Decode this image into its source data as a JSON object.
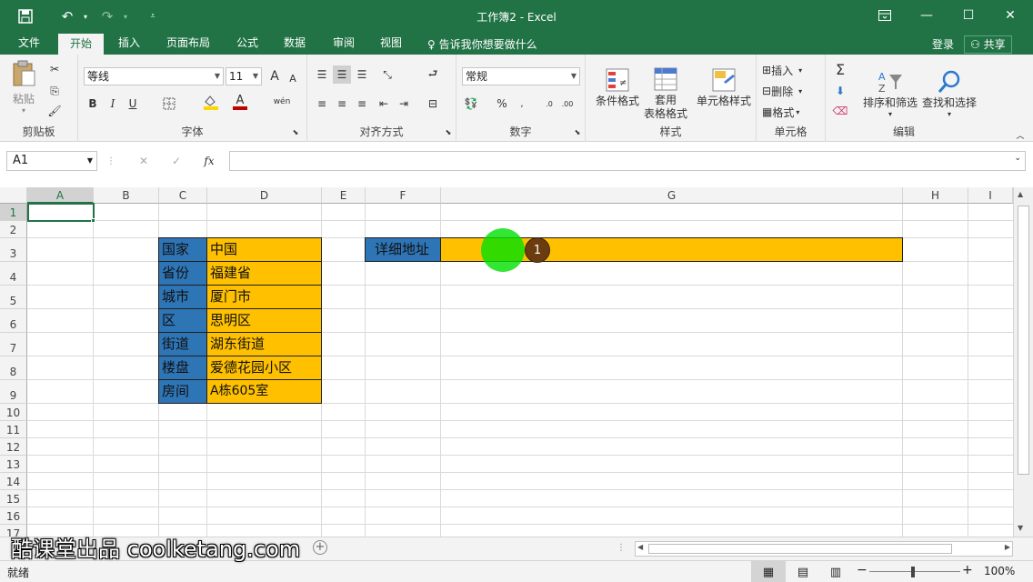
{
  "title": {
    "text": "工作簿2 - Excel",
    "save_icon": "save-icon",
    "undo_icon": "undo-icon",
    "redo_icon": "redo-icon",
    "customize_icon": "customize-qat-icon"
  },
  "tabs": [
    "文件",
    "开始",
    "插入",
    "页面布局",
    "公式",
    "数据",
    "审阅",
    "视图"
  ],
  "tell_me": "♀ 告诉我你想要做什么",
  "login": "登录",
  "share": "共享",
  "ribbon": {
    "clipboard": {
      "paste": "粘贴",
      "group": "剪贴板"
    },
    "font": {
      "name": "等线",
      "size": "11",
      "group": "字体",
      "bold": "B",
      "italic": "I",
      "underline": "U",
      "grow": "A",
      "shrink": "A",
      "font_color": "A",
      "wen": "wén"
    },
    "align": {
      "group": "对齐方式"
    },
    "number": {
      "format": "常规",
      "group": "数字",
      "percent": "%"
    },
    "styles": {
      "conditional": "条件格式",
      "table_line1": "套用",
      "table_line2": "表格格式",
      "cell_styles": "单元格样式",
      "group": "样式"
    },
    "cells": {
      "insert": "插入",
      "delete": "删除",
      "format": "格式",
      "group": "单元格"
    },
    "editing": {
      "sort": "排序和筛选",
      "find": "查找和选择",
      "group": "编辑"
    }
  },
  "formula_bar": {
    "name_box": "A1",
    "fx": "fx",
    "value": ""
  },
  "columns": [
    "A",
    "B",
    "C",
    "D",
    "E",
    "F",
    "G",
    "H",
    "I"
  ],
  "rows": [
    "1",
    "2",
    "3",
    "4",
    "5",
    "6",
    "7",
    "8",
    "9",
    "10",
    "11",
    "12",
    "13",
    "14",
    "15",
    "16",
    "17"
  ],
  "table": [
    {
      "label": "国家",
      "value": "中国"
    },
    {
      "label": "省份",
      "value": "福建省"
    },
    {
      "label": "城市",
      "value": "厦门市"
    },
    {
      "label": "区",
      "value": "思明区"
    },
    {
      "label": "街道",
      "value": "湖东街道"
    },
    {
      "label": "楼盘",
      "value": "爱德花园小区"
    },
    {
      "label": "房间",
      "value": "A栋605室"
    }
  ],
  "address": {
    "label": "详细地址",
    "value": ""
  },
  "marker": {
    "step": "1"
  },
  "status": {
    "ready": "就绪",
    "zoom": "100%"
  },
  "watermark": "酷课堂出品 coolketang.com",
  "colors": {
    "brand": "#217346",
    "blue_cell": "#2e75b6",
    "gold_cell": "#ffc000",
    "cursor": "#00e000"
  }
}
